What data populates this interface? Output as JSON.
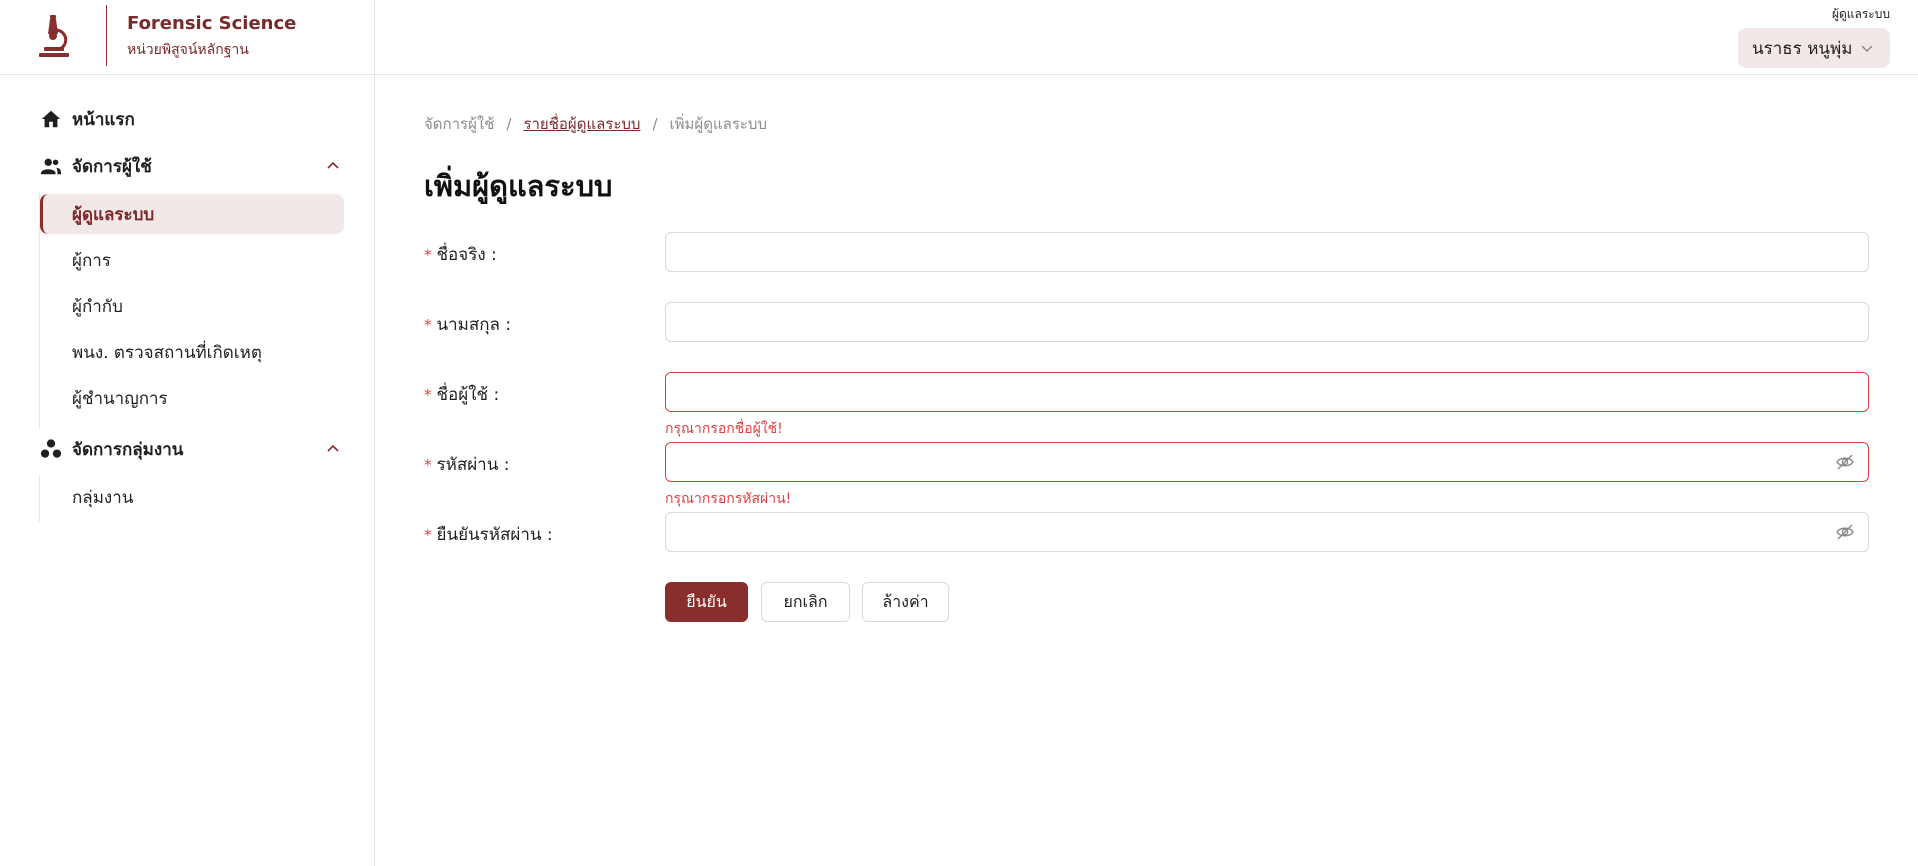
{
  "header": {
    "brand_title": "Forensic Science",
    "brand_subtitle": "หน่วยพิสูจน์หลักฐาน",
    "role_label": "ผู้ดูแลระบบ",
    "user_name": "นราธร หนูพุ่ม",
    "accent_color": "#8a2d2d"
  },
  "sidebar": {
    "home": {
      "label": "หน้าแรก",
      "icon": "home-icon"
    },
    "user_mgmt": {
      "label": "จัดการผู้ใช้",
      "icon": "users-icon",
      "items": [
        {
          "label": "ผู้ดูแลระบบ",
          "active": true
        },
        {
          "label": "ผู้การ"
        },
        {
          "label": "ผู้กำกับ"
        },
        {
          "label": "พนง. ตรวจสถานที่เกิดเหตุ"
        },
        {
          "label": "ผู้ชำนาญการ"
        }
      ]
    },
    "group_mgmt": {
      "label": "จัดการกลุ่มงาน",
      "icon": "group-icon",
      "items": [
        {
          "label": "กลุ่มงาน"
        }
      ]
    }
  },
  "breadcrumb": {
    "items": [
      "จัดการผู้ใช้",
      "รายชื่อผู้ดูแลระบบ",
      "เพิ่มผู้ดูแลระบบ"
    ],
    "separator": "/"
  },
  "page": {
    "title": "เพิ่มผู้ดูแลระบบ"
  },
  "form": {
    "required_mark": "*",
    "first_name": {
      "label": "ชื่อจริง :",
      "value": ""
    },
    "last_name": {
      "label": "นามสกุล :",
      "value": ""
    },
    "username": {
      "label": "ชื่อผู้ใช้ :",
      "value": "",
      "error": "กรุณากรอกชื่อผู้ใช้!"
    },
    "password": {
      "label": "รหัสผ่าน :",
      "value": "",
      "error": "กรุณากรอกรหัสผ่าน!"
    },
    "confirm_password": {
      "label": "ยืนยันรหัสผ่าน :",
      "value": ""
    },
    "buttons": {
      "submit": "ยืนยัน",
      "cancel": "ยกเลิก",
      "reset": "ล้างค่า"
    }
  }
}
